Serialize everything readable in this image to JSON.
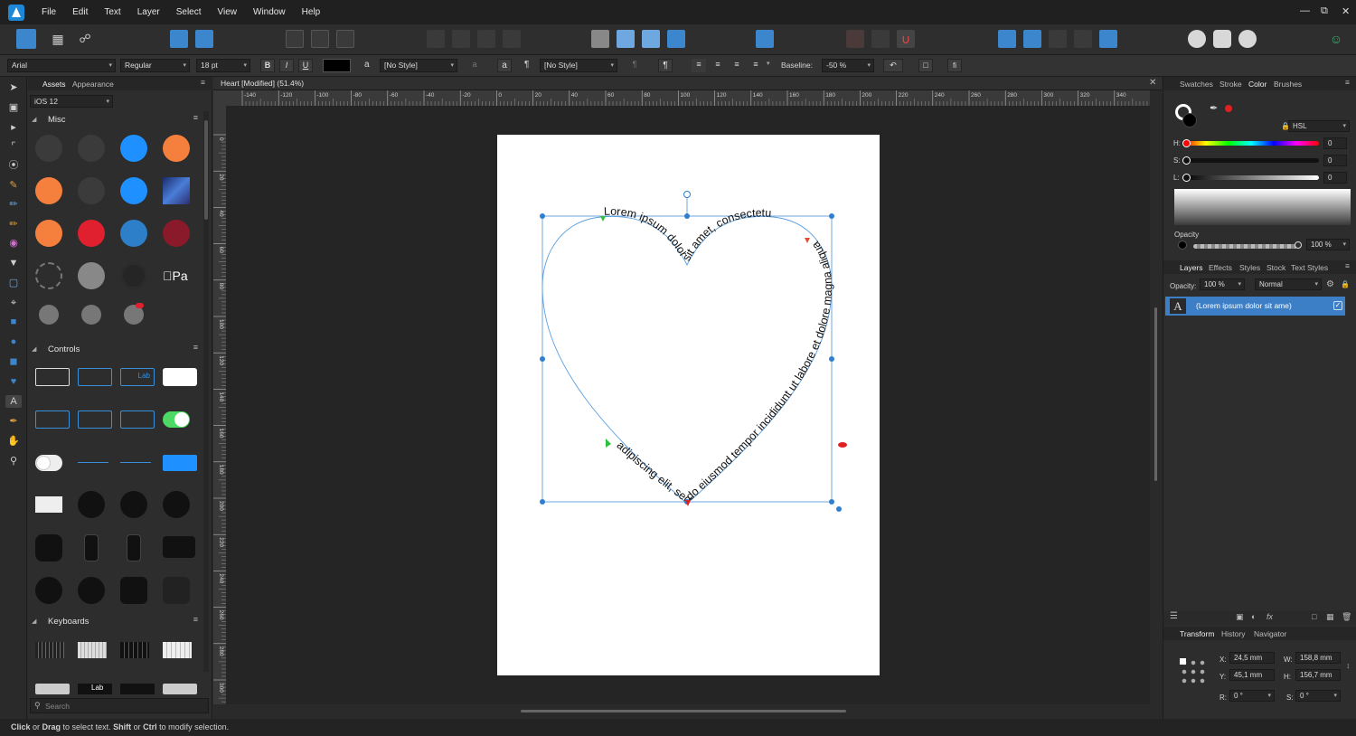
{
  "menu": {
    "items": [
      "File",
      "Edit",
      "Text",
      "Layer",
      "Select",
      "View",
      "Window",
      "Help"
    ]
  },
  "context_bar": {
    "font_family": "Arial",
    "font_style": "Regular",
    "font_size": "18 pt",
    "bold": "B",
    "italic": "I",
    "underline": "U",
    "char_style_icon": "a",
    "char_style": "[No Style]",
    "char_a": "a",
    "para_icon": "¶",
    "para_style": "[No Style]",
    "para_mark": "¶",
    "baseline_label": "Baseline:",
    "baseline_value": "-50 %",
    "ligature": "fi"
  },
  "assets": {
    "tabs": [
      "Assets",
      "Appearance"
    ],
    "category": "iOS 12",
    "sections": [
      "Misc",
      "Controls",
      "Keyboards"
    ],
    "ctl_label": "Lab",
    "search_placeholder": "Search"
  },
  "document": {
    "title": "Heart [Modified] (51.4%)",
    "ruler_h": [
      "-140",
      "-120",
      "-100",
      "-80",
      "-60",
      "-40",
      "-20",
      "0",
      "20",
      "40",
      "60",
      "80",
      "100",
      "120",
      "140",
      "160",
      "180",
      "200",
      "220",
      "240",
      "260",
      "280",
      "300",
      "320",
      "340"
    ],
    "ruler_v": [
      "0",
      "20",
      "40",
      "60",
      "80",
      "100",
      "120",
      "140",
      "160",
      "180",
      "200",
      "220",
      "240",
      "260",
      "280",
      "300"
    ],
    "path_text": "Lorem ipsum dolor sit amet, consectetur adipiscing elit, sed do eiusmod tempor incididunt ut labore et dolore magna aliqua",
    "path_text_part1": "adipiscing elit, sed do eiusmod tempor incididunt ut labore et dolore magna aliqua"
  },
  "right_panel": {
    "top_tabs": [
      "Swatches",
      "Stroke",
      "Color",
      "Brushes"
    ],
    "color_mode": "HSL",
    "h_label": "H:",
    "h_value": "0",
    "s_label": "S:",
    "s_value": "0",
    "l_label": "L:",
    "l_value": "0",
    "opacity_label": "Opacity",
    "opacity_value": "100 %",
    "layer_tabs": [
      "Layers",
      "Effects",
      "Styles",
      "Stock",
      "Text Styles"
    ],
    "layer_opacity_label": "Opacity:",
    "layer_opacity_value": "100 %",
    "blend_mode": "Normal",
    "layer_name": "(Lorem ipsum dolor sit ame)",
    "layer_icon_letter": "A",
    "bottom_tabs": [
      "Transform",
      "History",
      "Navigator"
    ],
    "transform": {
      "x_label": "X:",
      "x": "24,5 mm",
      "y_label": "Y:",
      "y": "45,1 mm",
      "w_label": "W:",
      "w": "158,8 mm",
      "h_label": "H:",
      "h": "156,7 mm",
      "r_label": "R:",
      "r": "0 °",
      "s_label": "S:",
      "s": "0 °"
    }
  },
  "status": {
    "click": "Click",
    "or1": " or ",
    "drag": "Drag",
    "to_select": " to select text. ",
    "shift": "Shift",
    "or2": " or ",
    "ctrl": "Ctrl",
    "modify": " to modify selection."
  },
  "colors": {
    "accent": "#3b86cc",
    "selection": "#2f7fd0",
    "heart_path": "#5b9fe0",
    "layer_highlight": "#3d7fc6"
  }
}
